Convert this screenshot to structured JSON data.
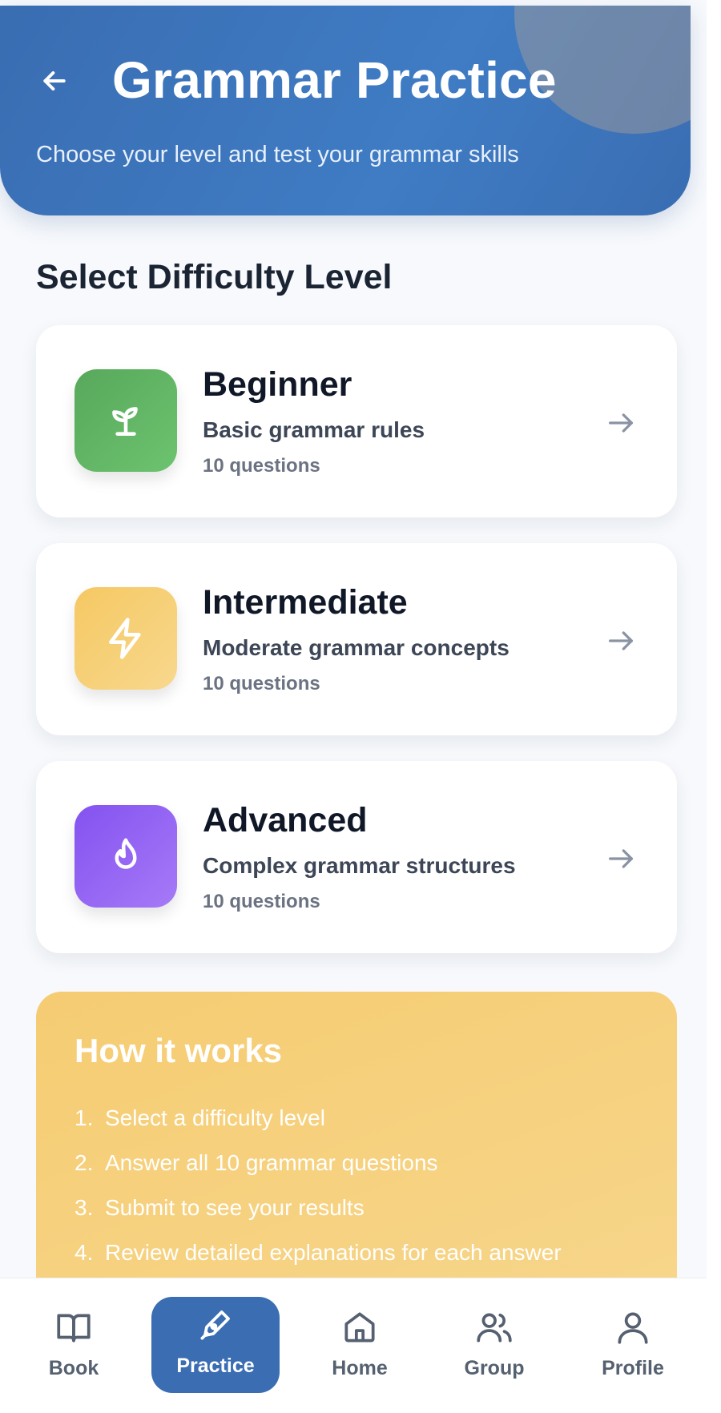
{
  "header": {
    "title": "Grammar Practice",
    "subtitle": "Choose your level and test your grammar skills",
    "back_icon": "arrow-left-icon"
  },
  "section_title": "Select Difficulty Level",
  "levels": [
    {
      "title": "Beginner",
      "description": "Basic grammar rules",
      "count": "10 questions",
      "icon": "sprout-icon",
      "color": "#5fb563"
    },
    {
      "title": "Intermediate",
      "description": "Moderate grammar concepts",
      "count": "10 questions",
      "icon": "lightning-icon",
      "color": "#f6c966"
    },
    {
      "title": "Advanced",
      "description": "Complex grammar structures",
      "count": "10 questions",
      "icon": "flame-icon",
      "color": "#8b5cf6"
    }
  ],
  "how_it_works": {
    "title": "How it works",
    "steps": [
      {
        "num": "1.",
        "text": "Select a difficulty level"
      },
      {
        "num": "2.",
        "text": "Answer all 10 grammar questions"
      },
      {
        "num": "3.",
        "text": "Submit to see your results"
      },
      {
        "num": "4.",
        "text": "Review detailed explanations for each answer"
      }
    ]
  },
  "nav": {
    "active": "Practice",
    "items": [
      {
        "label": "Book",
        "icon": "book-icon"
      },
      {
        "label": "Practice",
        "icon": "pen-icon"
      },
      {
        "label": "Home",
        "icon": "home-icon"
      },
      {
        "label": "Group",
        "icon": "group-icon"
      },
      {
        "label": "Profile",
        "icon": "user-icon"
      }
    ]
  },
  "colors": {
    "primary": "#3a6db2",
    "accent_yellow": "#f5cc72",
    "text_dark": "#1b2433"
  }
}
